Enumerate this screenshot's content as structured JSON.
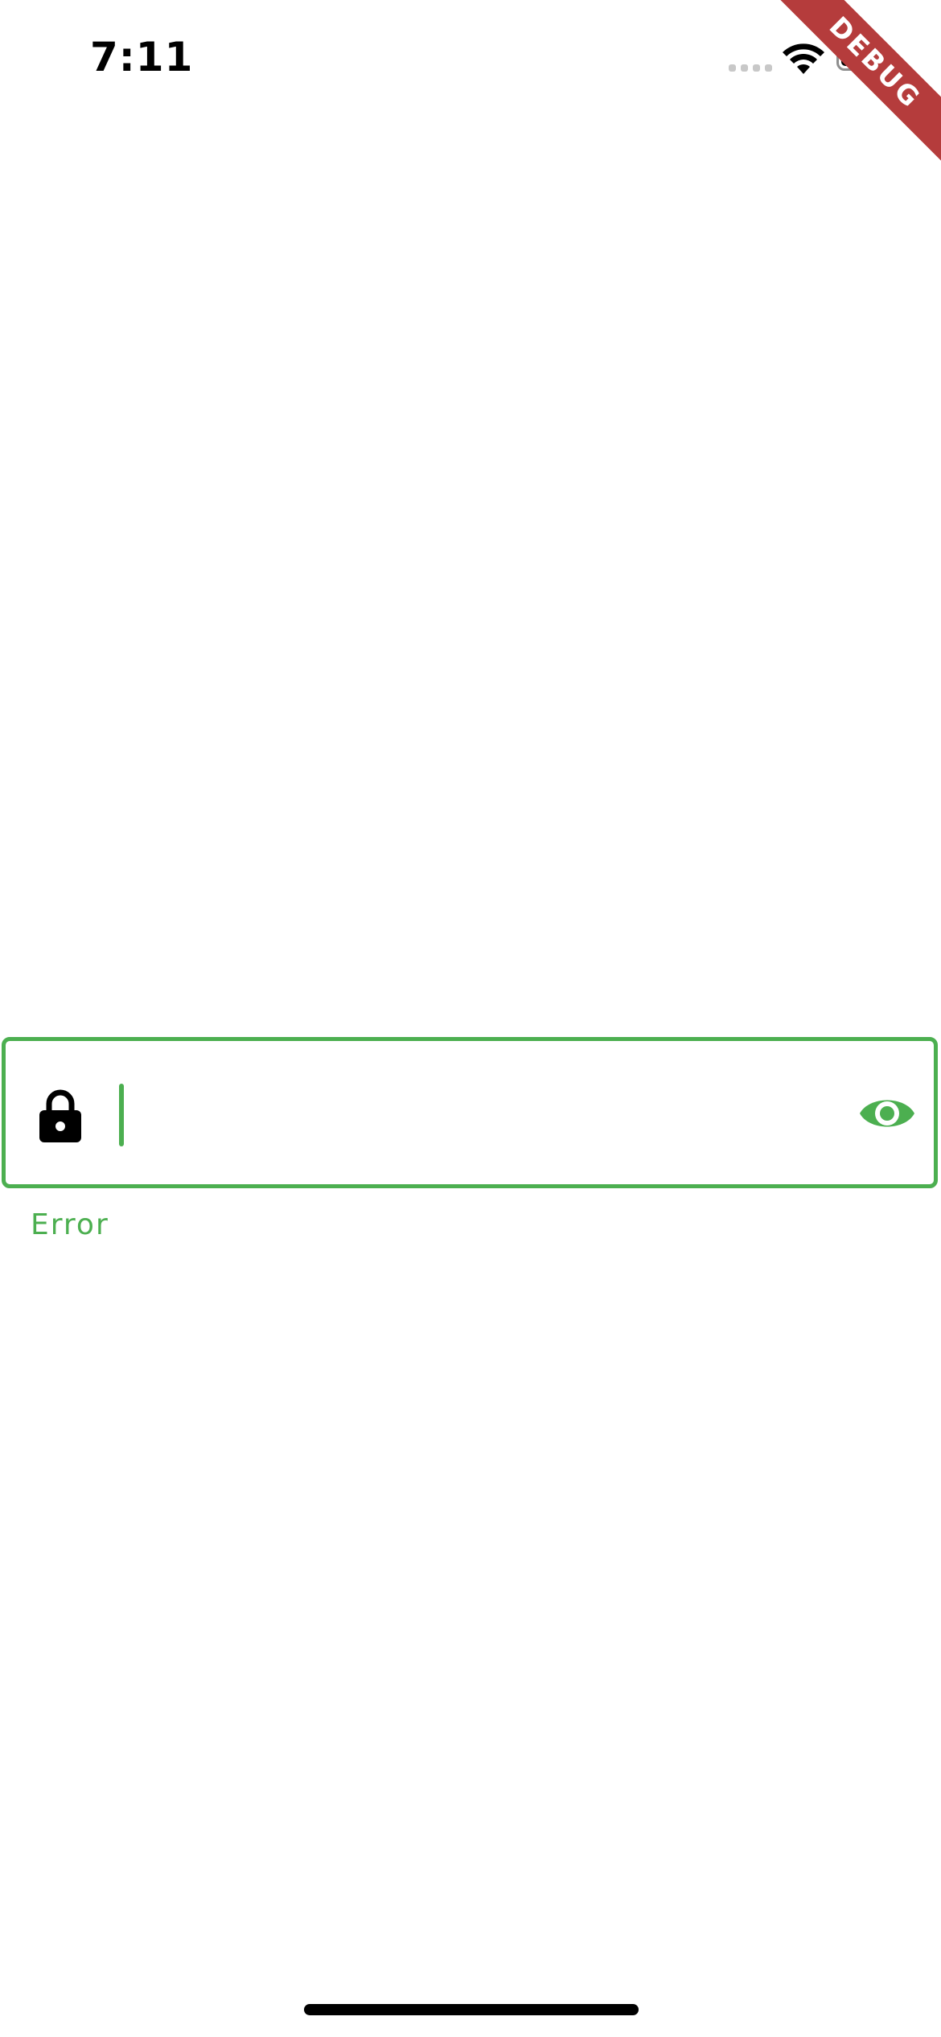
{
  "status_bar": {
    "time": "7:11"
  },
  "debug_banner": {
    "label": "DEBUG"
  },
  "password_field": {
    "value": "",
    "leading_icon": "lock-icon",
    "trailing_icon": "eye-icon",
    "helper_text": "Error",
    "accent_color": "#4caf50"
  }
}
